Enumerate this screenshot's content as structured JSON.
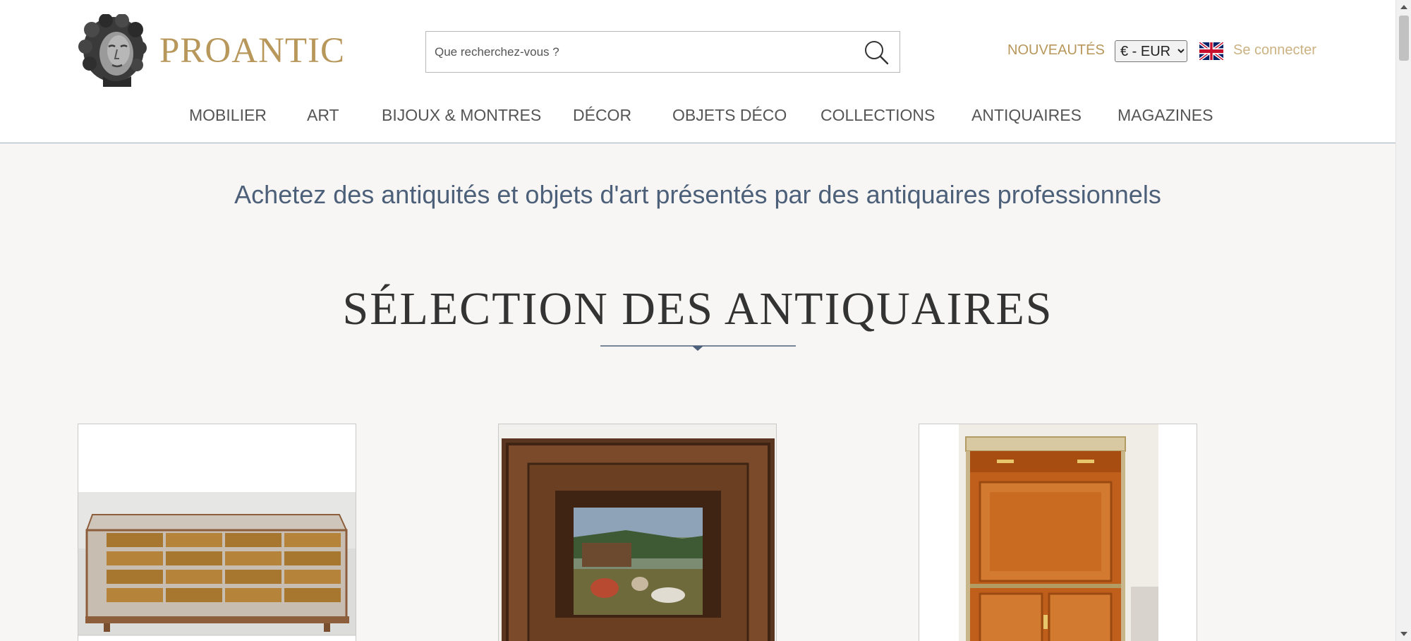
{
  "header": {
    "logo_text": "PROANTIC",
    "search": {
      "placeholder": "Que recherchez-vous ?"
    },
    "nouveautes_label": "NOUVEAUTÉS",
    "currency_options": [
      "€ - EUR"
    ],
    "currency_selected": "€ - EUR",
    "language_flag": "uk-flag-icon",
    "login_label": "Se connecter"
  },
  "nav": {
    "items": [
      {
        "label": "MOBILIER"
      },
      {
        "label": "ART"
      },
      {
        "label": "BIJOUX & MONTRES"
      },
      {
        "label": "DÉCOR"
      },
      {
        "label": "OBJETS DÉCO"
      },
      {
        "label": "COLLECTIONS"
      },
      {
        "label": "ANTIQUAIRES"
      },
      {
        "label": "MAGAZINES"
      }
    ]
  },
  "main": {
    "tagline": "Achetez des antiquités et objets d'art présentés par des antiquaires professionnels",
    "section_title": "SÉLECTION DES ANTIQUAIRES",
    "products": [
      {
        "image": "glass-display-cabinet-image"
      },
      {
        "image": "framed-pastoral-painting-image"
      },
      {
        "image": "secretary-desk-image"
      }
    ]
  },
  "colors": {
    "brand_gold": "#b8975b",
    "login_gold": "#cbb282",
    "tagline_blue": "#4d6079",
    "nav_text": "#555555",
    "title_text": "#333333",
    "page_bg": "#f7f6f4"
  }
}
